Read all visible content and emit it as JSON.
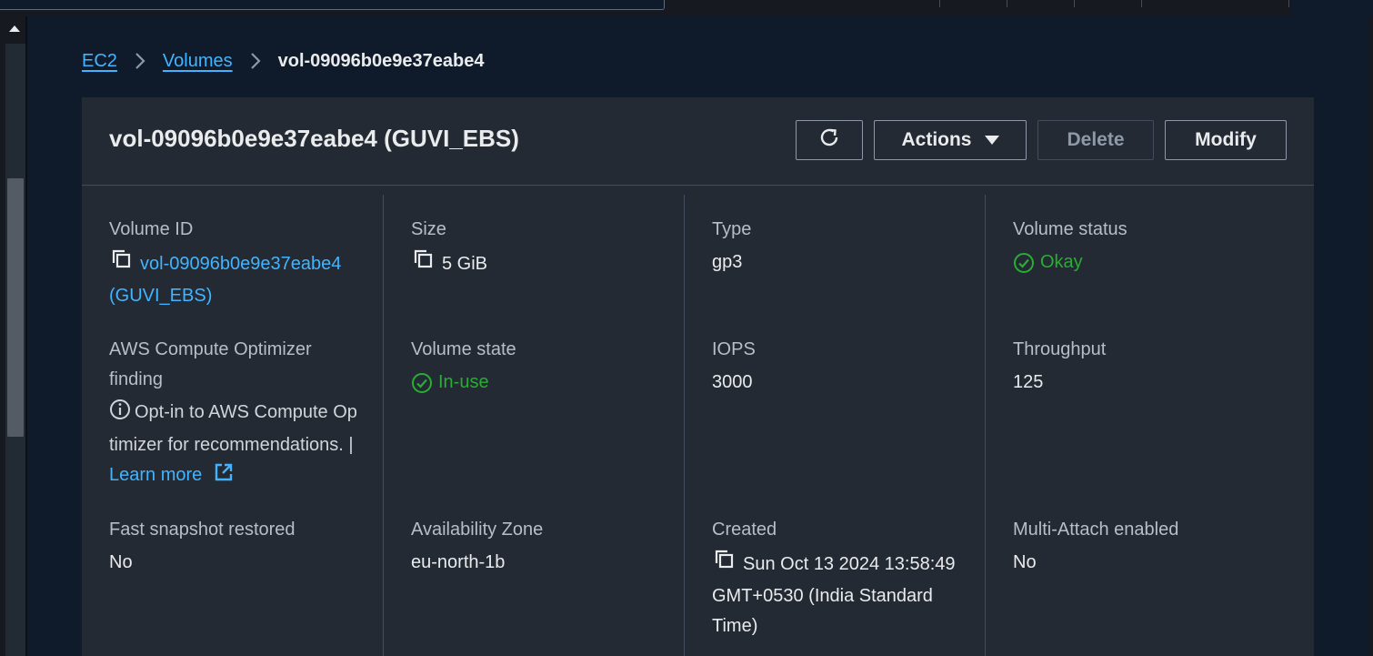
{
  "breadcrumb": {
    "items": [
      "EC2",
      "Volumes"
    ],
    "current": "vol-09096b0e9e37eabe4"
  },
  "header": {
    "title": "vol-09096b0e9e37eabe4 (GUVI_EBS)",
    "actions_label": "Actions",
    "delete_label": "Delete",
    "modify_label": "Modify"
  },
  "details": {
    "volume_id": {
      "label": "Volume ID",
      "value_line1": "vol-09096b0e9e37eabe4",
      "value_line2": "(GUVI_EBS)"
    },
    "size": {
      "label": "Size",
      "value": "5 GiB"
    },
    "type": {
      "label": "Type",
      "value": "gp3"
    },
    "volume_status": {
      "label": "Volume status",
      "value": "Okay"
    },
    "optimizer": {
      "label_line1": "AWS Compute Optimizer",
      "label_line2": "finding",
      "text_line1": "Opt-in to AWS Compute Op",
      "text_line2": "timizer for recommendations. |",
      "learn_more": "Learn more"
    },
    "volume_state": {
      "label": "Volume state",
      "value": "In-use"
    },
    "iops": {
      "label": "IOPS",
      "value": "3000"
    },
    "throughput": {
      "label": "Throughput",
      "value": "125"
    },
    "fast_snapshot": {
      "label": "Fast snapshot restored",
      "value": "No"
    },
    "availability_zone": {
      "label": "Availability Zone",
      "value": "eu-north-1b"
    },
    "created": {
      "label": "Created",
      "value_line1": "Sun Oct 13 2024 13:58:49",
      "value_line2": "GMT+0530 (India Standard",
      "value_line3": "Time)"
    },
    "multi_attach": {
      "label": "Multi-Attach enabled",
      "value": "No"
    }
  },
  "colors": {
    "background": "#0f1b2a",
    "panel": "#232a33",
    "link": "#42b4ff",
    "success": "#29ad32",
    "text": "#e9ebed",
    "label": "#b6bec9",
    "divider": "#414d5c"
  },
  "icons": [
    "refresh-icon",
    "caret-down-icon",
    "chevron-right-icon",
    "copy-icon",
    "check-circle-icon",
    "info-icon",
    "external-link-icon",
    "scroll-up-arrow-icon"
  ]
}
